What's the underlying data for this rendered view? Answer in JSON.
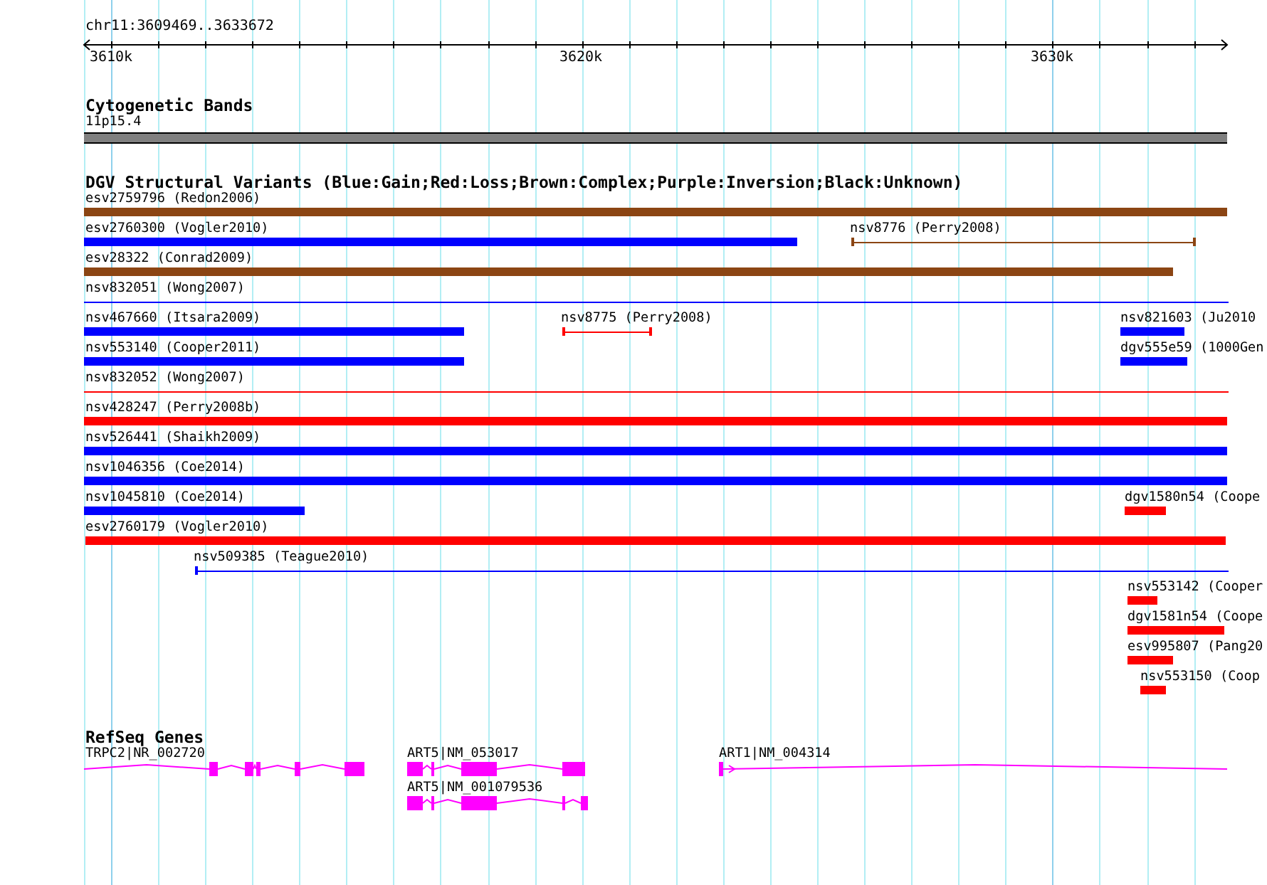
{
  "ruler": {
    "region": "chr11:3609469..3633672",
    "tick_labels": [
      "3610k",
      "3620k",
      "3630k"
    ]
  },
  "tracks": [
    {
      "kind": "cytoband",
      "title": "Cytogenetic Bands",
      "rows": [
        {
          "features": [
            {
              "label": "11p15.4"
            }
          ]
        }
      ]
    },
    {
      "kind": "variants",
      "title": "DGV Structural Variants (Blue:Gain;Red:Loss;Brown:Complex;Purple:Inversion;Black:Unknown)",
      "rows": [
        {
          "features": [
            {
              "label": "esv2759796 (Redon2006)",
              "kind": "bar",
              "color": "#8b4513"
            }
          ]
        },
        {
          "features": [
            {
              "label": "esv2760300 (Vogler2010)",
              "kind": "bar",
              "color": "#0000ff"
            },
            {
              "label": "nsv8776 (Perry2008)",
              "kind": "span",
              "color": "#8b4513"
            }
          ]
        },
        {
          "features": [
            {
              "label": "esv28322 (Conrad2009)",
              "kind": "bar",
              "color": "#8b4513"
            }
          ]
        },
        {
          "features": [
            {
              "label": "nsv832051 (Wong2007)",
              "kind": "span",
              "color": "#0000ff"
            }
          ]
        },
        {
          "features": [
            {
              "label": "nsv467660 (Itsara2009)",
              "kind": "bar",
              "color": "#0000ff"
            },
            {
              "label": "nsv8775 (Perry2008)",
              "kind": "span",
              "color": "#ff0000"
            },
            {
              "label": "nsv821603 (Ju2010",
              "kind": "bar",
              "color": "#0000ff"
            }
          ]
        },
        {
          "features": [
            {
              "label": "nsv553140 (Cooper2011)",
              "kind": "bar",
              "color": "#0000ff"
            },
            {
              "label": "dgv555e59 (1000Gen",
              "kind": "bar",
              "color": "#0000ff"
            }
          ]
        },
        {
          "features": [
            {
              "label": "nsv832052 (Wong2007)",
              "kind": "span",
              "color": "#ff0000"
            }
          ]
        },
        {
          "features": [
            {
              "label": "nsv428247 (Perry2008b)",
              "kind": "bar",
              "color": "#ff0000"
            }
          ]
        },
        {
          "features": [
            {
              "label": "nsv526441 (Shaikh2009)",
              "kind": "bar",
              "color": "#0000ff"
            }
          ]
        },
        {
          "features": [
            {
              "label": "nsv1046356 (Coe2014)",
              "kind": "bar",
              "color": "#0000ff"
            }
          ]
        },
        {
          "features": [
            {
              "label": "nsv1045810 (Coe2014)",
              "kind": "bar",
              "color": "#0000ff"
            },
            {
              "label": "dgv1580n54 (Coope",
              "kind": "bar",
              "color": "#ff0000"
            }
          ]
        },
        {
          "features": [
            {
              "label": "esv2760179 (Vogler2010)",
              "kind": "bar",
              "color": "#ff0000"
            }
          ]
        },
        {
          "features": [
            {
              "label": "nsv509385 (Teague2010)",
              "kind": "span",
              "color": "#0000ff"
            }
          ]
        },
        {
          "features": [
            {
              "label": "nsv553142 (Cooper",
              "kind": "bar",
              "color": "#ff0000"
            }
          ]
        },
        {
          "features": [
            {
              "label": "dgv1581n54 (Coope",
              "kind": "bar",
              "color": "#ff0000"
            }
          ]
        },
        {
          "features": [
            {
              "label": "esv995807 (Pang20",
              "kind": "bar",
              "color": "#ff0000"
            }
          ]
        },
        {
          "features": [
            {
              "label": "nsv553150 (Coop",
              "kind": "bar",
              "color": "#ff0000"
            }
          ]
        }
      ]
    },
    {
      "kind": "genes",
      "title": "RefSeq Genes",
      "rows": [
        {
          "features": [
            {
              "label": "TRPC2|NR_002720"
            },
            {
              "label": "ART5|NM_053017"
            },
            {
              "label": "ART1|NM_004314"
            }
          ]
        },
        {
          "features": [
            {
              "label": "ART5|NM_001079536"
            }
          ]
        }
      ]
    }
  ]
}
